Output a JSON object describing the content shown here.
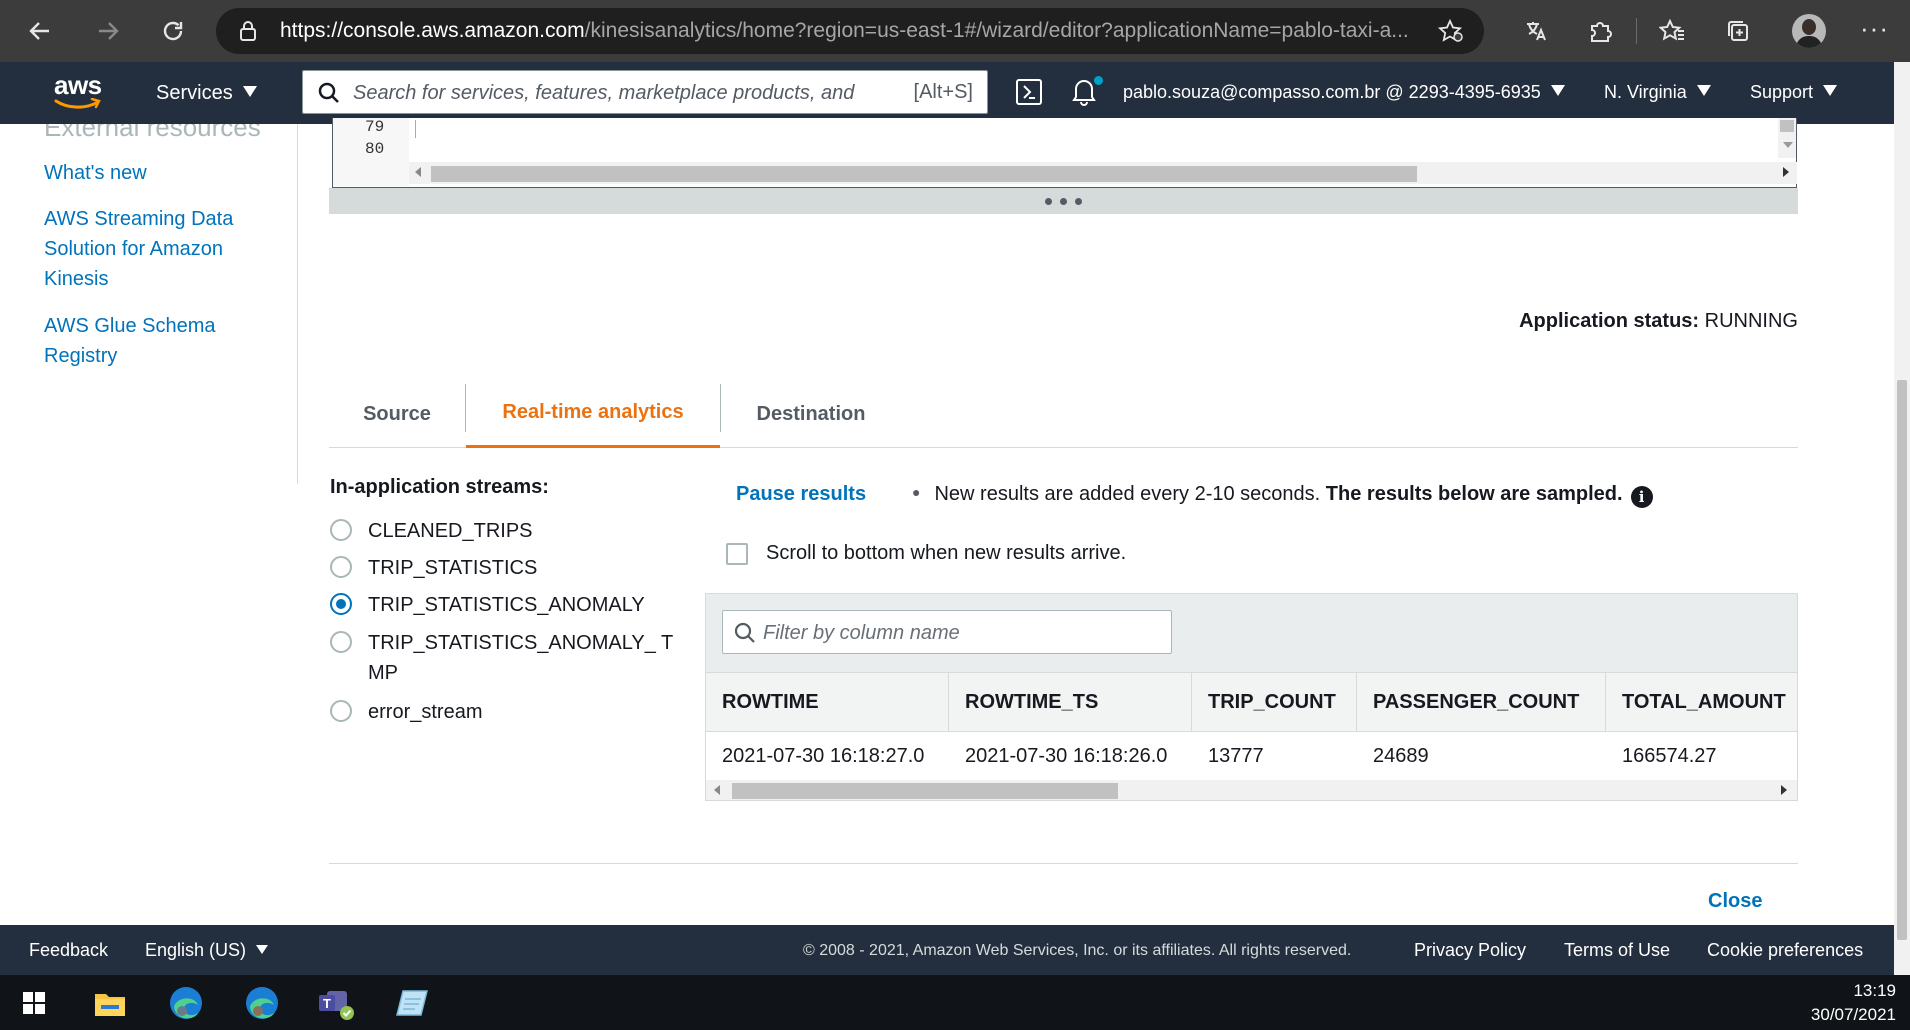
{
  "browser": {
    "url_host": "https://console.aws.amazon.com",
    "url_rest": "/kinesisanalytics/home?region=us-east-1#/wizard/editor?applicationName=pablo-taxi-a..."
  },
  "aws_nav": {
    "logo": "aws",
    "services_label": "Services",
    "search_placeholder": "Search for services, features, marketplace products, and",
    "search_shortcut": "[Alt+S]",
    "account": "pablo.souza@compasso.com.br @ 2293-4395-6935",
    "region": "N. Virginia",
    "support": "Support"
  },
  "sidebar": {
    "faded_heading": "External resources",
    "links": [
      "What's new",
      "AWS Streaming Data Solution for Amazon Kinesis",
      "AWS Glue Schema Registry"
    ]
  },
  "editor": {
    "line_numbers": [
      "79",
      "80"
    ]
  },
  "status": {
    "label": "Application status:",
    "value": "RUNNING"
  },
  "tabs": [
    {
      "label": "Source",
      "active": false
    },
    {
      "label": "Real-time analytics",
      "active": true
    },
    {
      "label": "Destination",
      "active": false
    }
  ],
  "streams": {
    "title": "In-application streams:",
    "items": [
      {
        "label": "CLEANED_TRIPS",
        "selected": false
      },
      {
        "label": "TRIP_STATISTICS",
        "selected": false
      },
      {
        "label": "TRIP_STATISTICS_ANOMALY",
        "selected": true
      },
      {
        "label": "TRIP_STATISTICS_ANOMALY_ TMP",
        "selected": false
      },
      {
        "label": "error_stream",
        "selected": false
      }
    ]
  },
  "results": {
    "pause_label": "Pause results",
    "info_text": "New results are added every 2-10 seconds.",
    "info_bold": "The results below are sampled.",
    "scroll_label": "Scroll to bottom when new results arrive.",
    "filter_placeholder": "Filter by column name",
    "columns": [
      "ROWTIME",
      "ROWTIME_TS",
      "TRIP_COUNT",
      "PASSENGER_COUNT",
      "TOTAL_AMOUNT"
    ],
    "rows": [
      [
        "2021-07-30 16:18:27.0",
        "2021-07-30 16:18:26.0",
        "13777",
        "24689",
        "166574.27"
      ]
    ]
  },
  "close_label": "Close",
  "footer": {
    "feedback": "Feedback",
    "language": "English (US)",
    "copyright": "© 2008 - 2021, Amazon Web Services, Inc. or its affiliates. All rights reserved.",
    "privacy": "Privacy Policy",
    "terms": "Terms of Use",
    "cookies": "Cookie preferences"
  },
  "taskbar": {
    "time": "13:19",
    "date": "30/07/2021"
  },
  "colors": {
    "aws_nav_bg": "#232f3e",
    "link": "#0073bb",
    "active_tab": "#ec7211"
  }
}
